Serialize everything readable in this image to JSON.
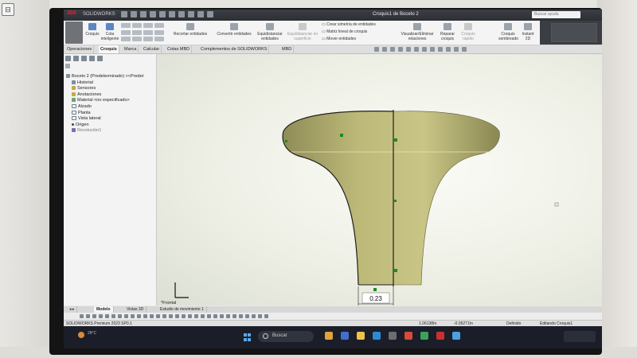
{
  "window": {
    "app_label": "SOLIDWORKS",
    "doc_title": "Croquis1 de Boceto 2",
    "search_placeholder": "Buscar ayuda"
  },
  "ribbon": {
    "sketch": "Croquis",
    "smart_dimension": "Cota inteligente",
    "trim": "Recortar entidades",
    "convert": "Convertir entidades",
    "offset": "Equidistanciar entidades",
    "offset_surface": "Equidistanciar en superficie",
    "mirror": "Crear simetría de entidades",
    "linear_pattern": "Matriz lineal de croquis",
    "move": "Mover entidades",
    "display_relations": "Visualizar/Eliminar relaciones",
    "repair": "Reparar croquis",
    "rapid": "Croquis rápido",
    "instant2d": "Instant 2D",
    "shaded": "Croquis sombreado"
  },
  "tabs": [
    "Operaciones",
    "Croquis",
    "Marca",
    "Calcular",
    "Cotas MBD",
    "Complementos de SOLIDWORKS",
    "MBD"
  ],
  "active_tab": "Croquis",
  "tree": [
    {
      "label": "Boceto 2 (Predeterminado) <<Predet",
      "icon": "part-icon"
    },
    {
      "label": "Historial",
      "icon": "history-icon"
    },
    {
      "label": "Sensores",
      "icon": "sensor-icon"
    },
    {
      "label": "Anotaciones",
      "icon": "annotation-icon"
    },
    {
      "label": "Material <no especificado>",
      "icon": "material-icon"
    },
    {
      "label": "Alzado",
      "icon": "plane-icon"
    },
    {
      "label": "Planta",
      "icon": "plane-icon"
    },
    {
      "label": "Vista lateral",
      "icon": "plane-icon"
    },
    {
      "label": "Origen",
      "icon": "origin-icon"
    },
    {
      "label": "Revolución1",
      "icon": "revolve-icon"
    }
  ],
  "view_label": "*Frontal",
  "dimension_value": "0.23",
  "bottom_tabs": [
    "Modelo",
    "Vistas 3D",
    "Estudio de movimiento 1"
  ],
  "status": {
    "left": "SOLIDWORKS Premium 2023 SP0.1",
    "x": "1.06138In",
    "y": "-0.05271In",
    "state": "Definido",
    "editing": "Editando Croquis1"
  },
  "taskbar": {
    "weather": "28°C",
    "search": "Buscar"
  },
  "colors": {
    "model_fill": "#bdb979",
    "model_shadow": "#8a8852",
    "sketch_line": "#222222",
    "relation_green": "#1f8a1f",
    "taskbar": "#1b1e28"
  }
}
